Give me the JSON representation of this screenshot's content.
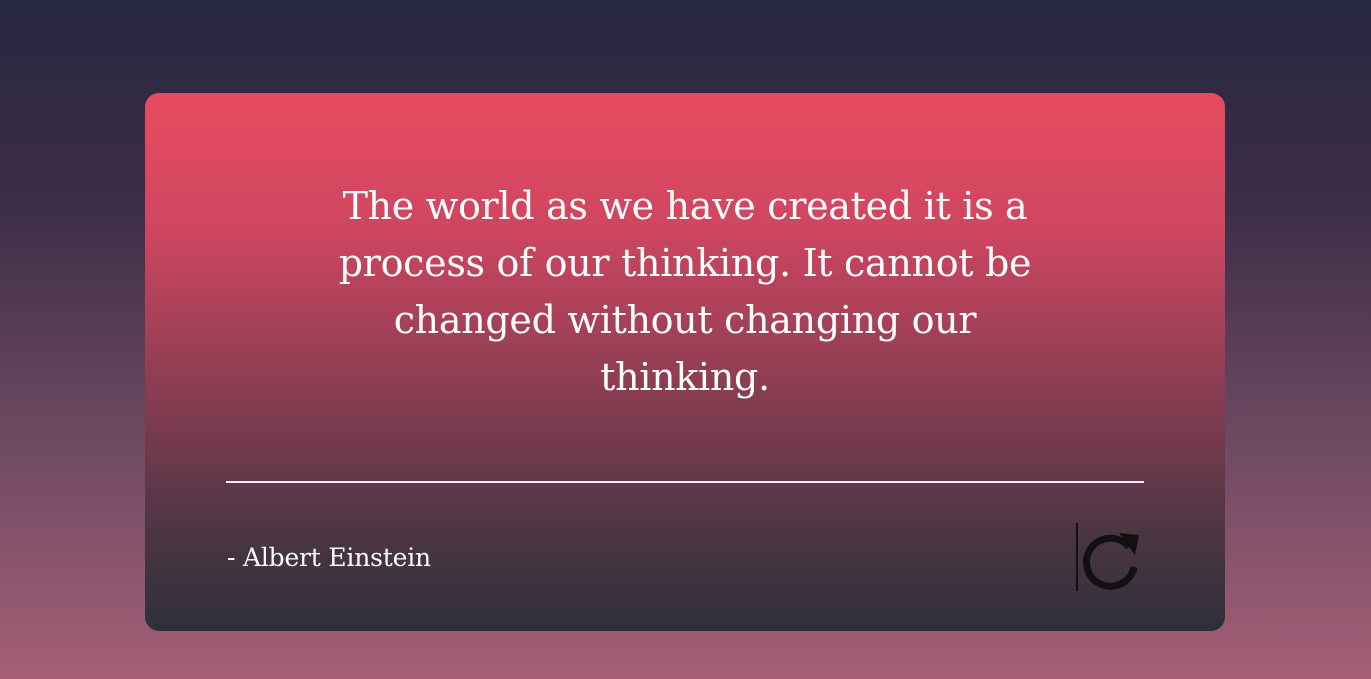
{
  "card": {
    "quote": "The world as we have created it is a process of our thinking. It cannot be changed without changing our thinking.",
    "author": "- Albert Einstein"
  },
  "actions": {
    "refresh_icon": "refresh-icon"
  },
  "colors": {
    "card_top": "#e84b60",
    "card_bottom": "#2f3039",
    "page_top": "#272740",
    "page_bottom": "#a55f76",
    "text": "#ffffff",
    "icon": "#111111"
  }
}
